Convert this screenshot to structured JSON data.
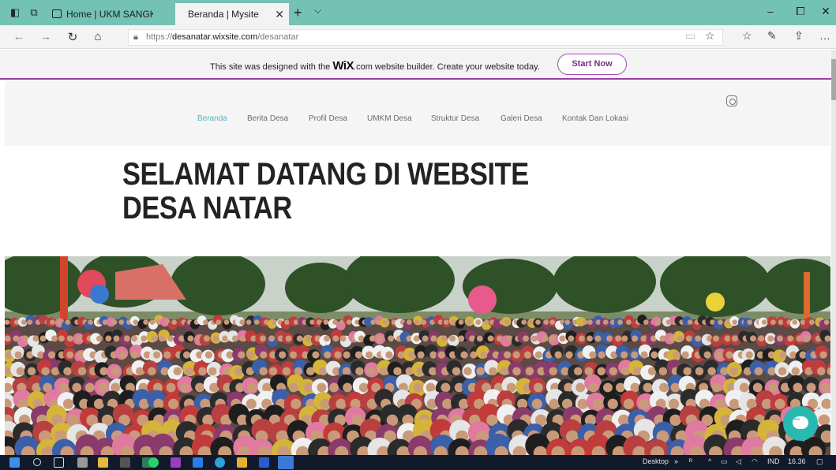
{
  "browser": {
    "tabs": [
      {
        "label": "Home | UKM SANGKAR BUI",
        "active": false
      },
      {
        "label": "Beranda | Mysite",
        "active": true
      }
    ],
    "new_tab_icon": "plus-icon",
    "close_glyph": "✕",
    "url_scheme": "https://",
    "url_domain": "desanatar.wixsite.com",
    "url_path": "/desanatar"
  },
  "wix_banner": {
    "text_before": "This site was designed with the ",
    "brand": "WiX",
    "text_after": ".com website builder. Create your website today.",
    "button": "Start Now",
    "accent_color": "#9b3aa8"
  },
  "site": {
    "menu": [
      {
        "label": "Beranda",
        "active": true
      },
      {
        "label": "Berita Desa",
        "active": false
      },
      {
        "label": "Profil Desa",
        "active": false
      },
      {
        "label": "UMKM Desa",
        "active": false
      },
      {
        "label": "Struktur Desa",
        "active": false
      },
      {
        "label": "Galeri Desa",
        "active": false
      },
      {
        "label": "Kontak Dan Lokasi",
        "active": false
      }
    ],
    "active_color": "#4fb7c6",
    "title": "SELAMAT DATANG DI WEBSITE DESA NATAR",
    "social_icon": "instagram-icon",
    "chat_icon": "chat-bubble-icon"
  },
  "taskbar": {
    "desktop_label": "Desktop",
    "chevron": "»",
    "language": "IND",
    "time": "16.36"
  }
}
